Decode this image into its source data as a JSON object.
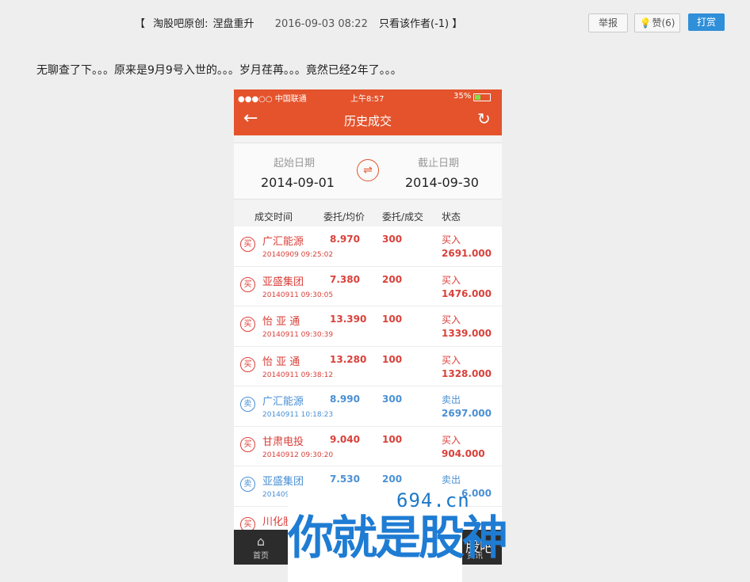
{
  "header": {
    "bracket_open": "【",
    "source": "淘股吧原创:",
    "title": "涅盘重升",
    "date": "2016-09-03 08:22",
    "only_author": "只看该作者(-1)",
    "bracket_close": "】",
    "report_label": "举报",
    "like_label": "赞(6)",
    "reward_label": "打赏"
  },
  "post": {
    "text": "无聊查了下。。。原来是9月9号入世的。。。岁月荏苒。。。竟然已经2年了。。。"
  },
  "phone": {
    "status": {
      "carrier": "●●●○○ 中国联通",
      "time": "上午8:57",
      "battery": "35%"
    },
    "nav_title": "历史成交",
    "start_label": "起始日期",
    "start_date": "2014-09-01",
    "end_label": "截止日期",
    "end_date": "2014-09-30",
    "swap_symbol": "⇌",
    "columns": [
      "成交时间",
      "委托/均价",
      "委托/成交",
      "状态"
    ],
    "rows": [
      {
        "side": "buy",
        "badge": "买",
        "name": "广汇能源",
        "time": "20140909 09:25:02",
        "price": "8.970",
        "qty": "300",
        "dir": "买入",
        "amount": "2691.000"
      },
      {
        "side": "buy",
        "badge": "买",
        "name": "亚盛集团",
        "time": "20140911 09:30:05",
        "price": "7.380",
        "qty": "200",
        "dir": "买入",
        "amount": "1476.000"
      },
      {
        "side": "buy",
        "badge": "买",
        "name": "怡 亚 通",
        "time": "20140911 09:30:39",
        "price": "13.390",
        "qty": "100",
        "dir": "买入",
        "amount": "1339.000"
      },
      {
        "side": "buy",
        "badge": "买",
        "name": "怡 亚 通",
        "time": "20140911 09:38:12",
        "price": "13.280",
        "qty": "100",
        "dir": "买入",
        "amount": "1328.000"
      },
      {
        "side": "sell",
        "badge": "卖",
        "name": "广汇能源",
        "time": "20140911 10:18:23",
        "price": "8.990",
        "qty": "300",
        "dir": "卖出",
        "amount": "2697.000"
      },
      {
        "side": "buy",
        "badge": "买",
        "name": "甘肃电投",
        "time": "20140912 09:30:20",
        "price": "9.040",
        "qty": "100",
        "dir": "买入",
        "amount": "904.000"
      },
      {
        "side": "sell",
        "badge": "卖",
        "name": "亚盛集团",
        "time": "20140912 ...",
        "price": "7.530",
        "qty": "200",
        "dir": "卖出",
        "amount": "1506.000"
      },
      {
        "side": "buy",
        "badge": "买",
        "name": "川化股份",
        "time": "20140912 ...",
        "price": "",
        "qty": "",
        "dir": "",
        "amount": "...000"
      }
    ],
    "tab_home": "首页",
    "tab_news": "资讯",
    "app_brand": "股吧"
  },
  "watermark": {
    "domain": "694.cn",
    "slogan": "你就是股神"
  }
}
